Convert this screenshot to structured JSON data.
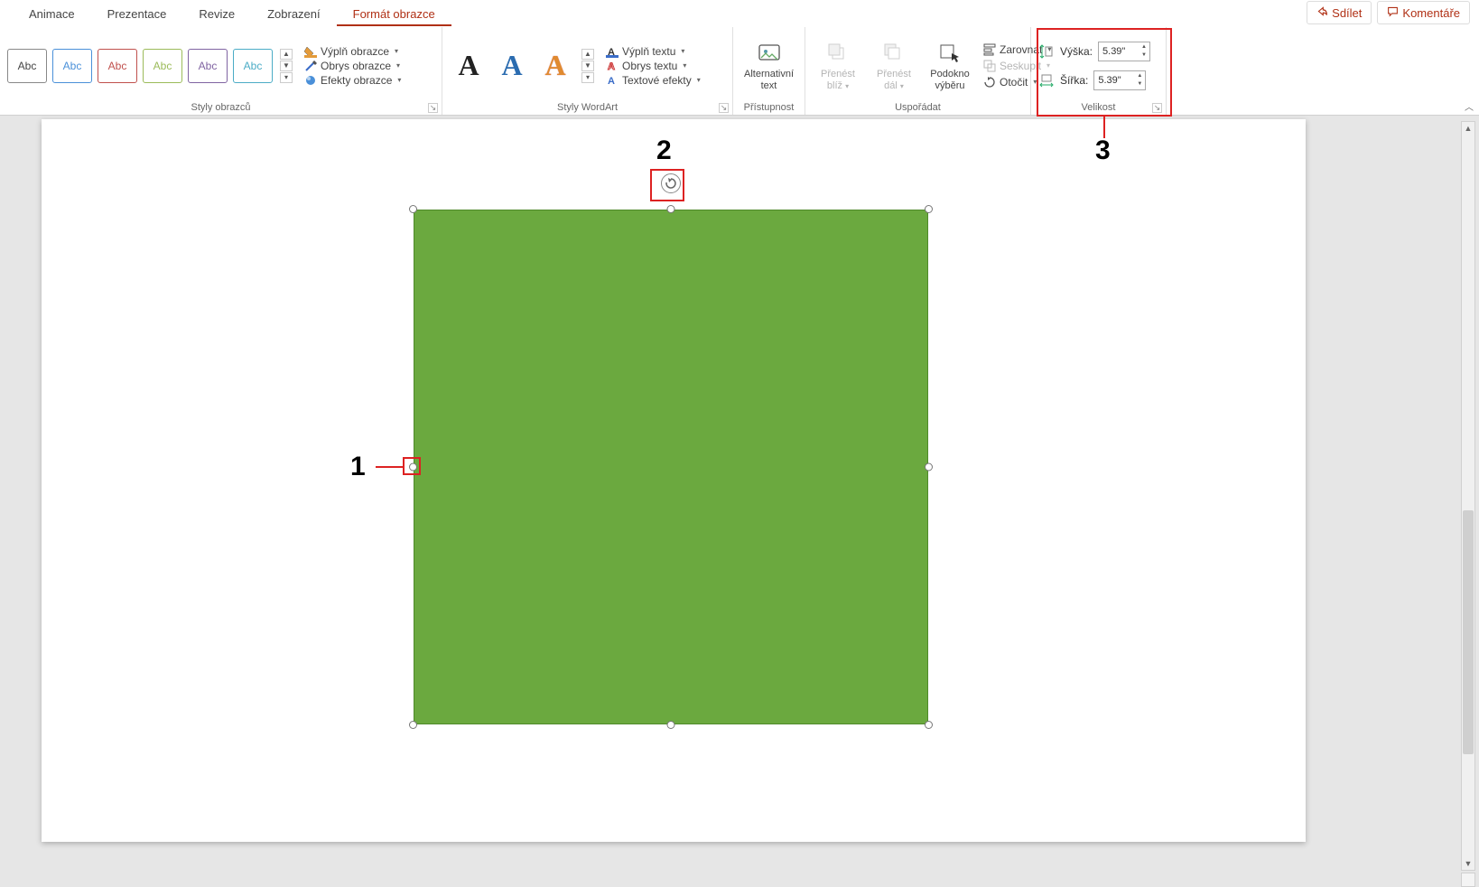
{
  "tabs": {
    "items": [
      "Animace",
      "Prezentace",
      "Revize",
      "Zobrazení",
      "Formát obrazce"
    ],
    "active_index": 4
  },
  "top_right": {
    "share": "Sdílet",
    "comments": "Komentáře"
  },
  "ribbon": {
    "shape_styles": {
      "abc": "Abc",
      "fill": "Výplň obrazce",
      "outline": "Obrys obrazce",
      "effects": "Efekty obrazce",
      "group_label": "Styly obrazců"
    },
    "wordart": {
      "letter": "A",
      "text_fill": "Výplň textu",
      "text_outline": "Obrys textu",
      "text_effects": "Textové efekty",
      "group_label": "Styly WordArt"
    },
    "accessibility": {
      "alt_text_l1": "Alternativní",
      "alt_text_l2": "text",
      "group_label": "Přístupnost"
    },
    "arrange": {
      "bring_l1": "Přenést",
      "bring_l2": "blíž",
      "send_l1": "Přenést",
      "send_l2": "dál",
      "selection_l1": "Podokno",
      "selection_l2": "výběru",
      "align": "Zarovnat",
      "group": "Seskupit",
      "rotate": "Otočit",
      "group_label": "Uspořádat"
    },
    "size": {
      "height_label": "Výška:",
      "height_value": "5.39\"",
      "width_label": "Šířka:",
      "width_value": "5.39\"",
      "group_label": "Velikost"
    }
  },
  "callouts": {
    "c1": "1",
    "c2": "2",
    "c3": "3"
  }
}
